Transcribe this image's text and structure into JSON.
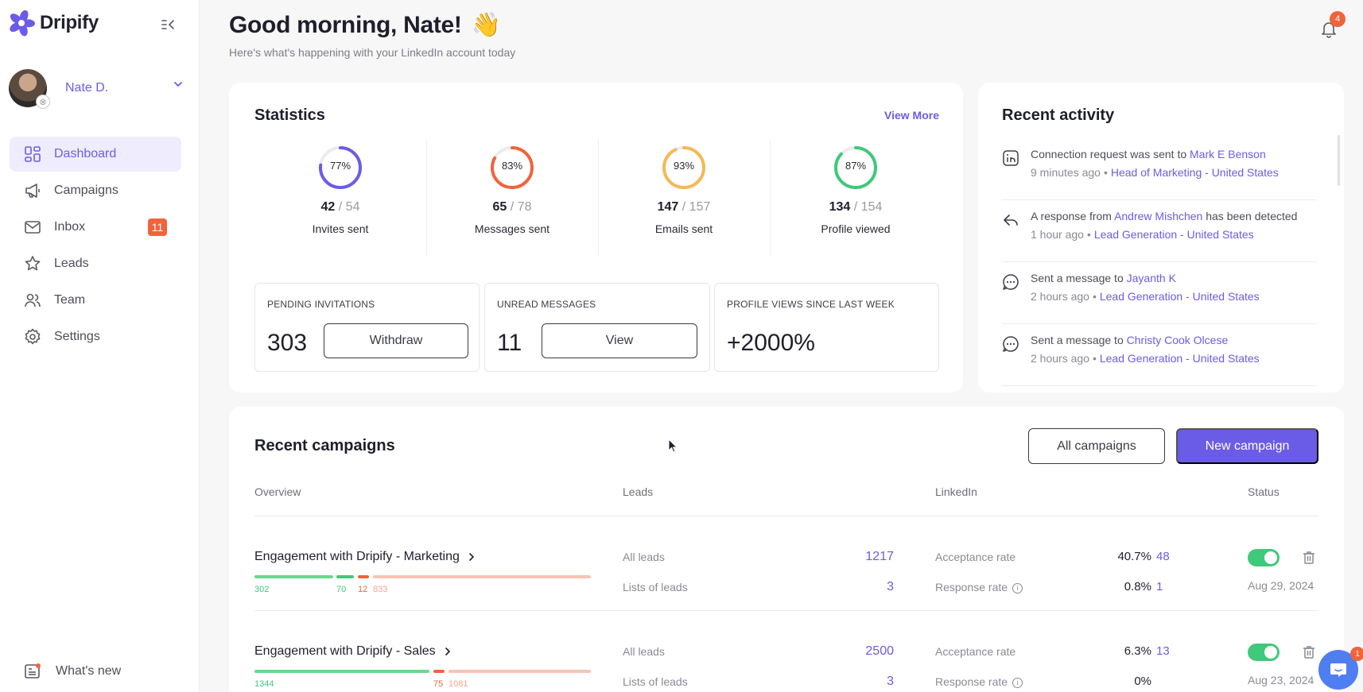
{
  "app": {
    "name": "Dripify"
  },
  "user": {
    "name": "Nate D."
  },
  "nav": [
    {
      "label": "Dashboard",
      "icon": "dashboard-icon",
      "active": true
    },
    {
      "label": "Campaigns",
      "icon": "megaphone-icon"
    },
    {
      "label": "Inbox",
      "icon": "mail-icon",
      "badge": "11"
    },
    {
      "label": "Leads",
      "icon": "leads-icon"
    },
    {
      "label": "Team",
      "icon": "team-icon"
    },
    {
      "label": "Settings",
      "icon": "gear-icon"
    }
  ],
  "whats_new": "What's new",
  "header": {
    "greeting": "Good morning, Nate!",
    "subtitle": "Here's what's happening with your LinkedIn account today",
    "notifications": "4"
  },
  "statistics": {
    "title": "Statistics",
    "view_more": "View More",
    "items": [
      {
        "pct": "77%",
        "value": "42",
        "total": "/ 54",
        "label": "Invites sent",
        "fraction": 0.77,
        "color": "#6b5ce7"
      },
      {
        "pct": "83%",
        "value": "65",
        "total": "/ 78",
        "label": "Messages sent",
        "fraction": 0.83,
        "color": "#f0643c"
      },
      {
        "pct": "93%",
        "value": "147",
        "total": "/ 157",
        "label": "Emails sent",
        "fraction": 0.93,
        "color": "#f5b955"
      },
      {
        "pct": "87%",
        "value": "134",
        "total": "/ 154",
        "label": "Profile viewed",
        "fraction": 0.87,
        "color": "#3fc97a"
      }
    ],
    "pending": {
      "title": "PENDING INVITATIONS",
      "value": "303",
      "button": "Withdraw"
    },
    "unread": {
      "title": "UNREAD MESSAGES",
      "value": "11",
      "button": "View"
    },
    "views": {
      "title": "PROFILE VIEWS SINCE LAST WEEK",
      "value": "+2000%"
    }
  },
  "activity": {
    "title": "Recent activity",
    "items": [
      {
        "icon": "linkedin-icon",
        "text": "Connection request was sent to",
        "person": "Mark E Benson",
        "time": "9 minutes ago",
        "campaign": "Head of Marketing - United States"
      },
      {
        "icon": "reply-icon",
        "text": "A response from",
        "person": "Andrew Mishchen",
        "text2": "has been detected",
        "time": "1 hour ago",
        "campaign": "Lead Generation - United States"
      },
      {
        "icon": "message-icon",
        "text": "Sent a message to",
        "person": "Jayanth K",
        "time": "2 hours ago",
        "campaign": "Lead Generation - United States"
      },
      {
        "icon": "message-icon",
        "text": "Sent a message to",
        "person": "Christy Cook Olcese",
        "time": "2 hours ago",
        "campaign": "Lead Generation - United States"
      }
    ]
  },
  "campaigns": {
    "title": "Recent campaigns",
    "all_button": "All campaigns",
    "new_button": "New campaign",
    "columns": [
      "Overview",
      "Leads",
      "LinkedIn",
      "Status"
    ],
    "rows": [
      {
        "name": "Engagement with Dripify - Marketing",
        "bar": {
          "n1": "302",
          "n2": "70",
          "n3": "12",
          "n4": "833"
        },
        "all_leads_label": "All leads",
        "all_leads": "1217",
        "lists_label": "Lists of leads",
        "lists": "3",
        "acceptance_label": "Acceptance rate",
        "acceptance": "40.7%",
        "acceptance_count": "48",
        "response_label": "Response rate",
        "response": "0.8%",
        "response_count": "1",
        "date": "Aug 29, 2024",
        "active": true
      },
      {
        "name": "Engagement with Dripify - Sales",
        "bar": {
          "n1": "1344",
          "n2": "",
          "n3": "75",
          "n4": "1081"
        },
        "all_leads_label": "All leads",
        "all_leads": "2500",
        "lists_label": "Lists of leads",
        "lists": "3",
        "acceptance_label": "Acceptance rate",
        "acceptance": "6.3%",
        "acceptance_count": "13",
        "response_label": "Response rate",
        "response": "0%",
        "response_count": "",
        "date": "Aug 23, 2024",
        "active": true
      }
    ]
  },
  "chat": {
    "badge": "1"
  }
}
